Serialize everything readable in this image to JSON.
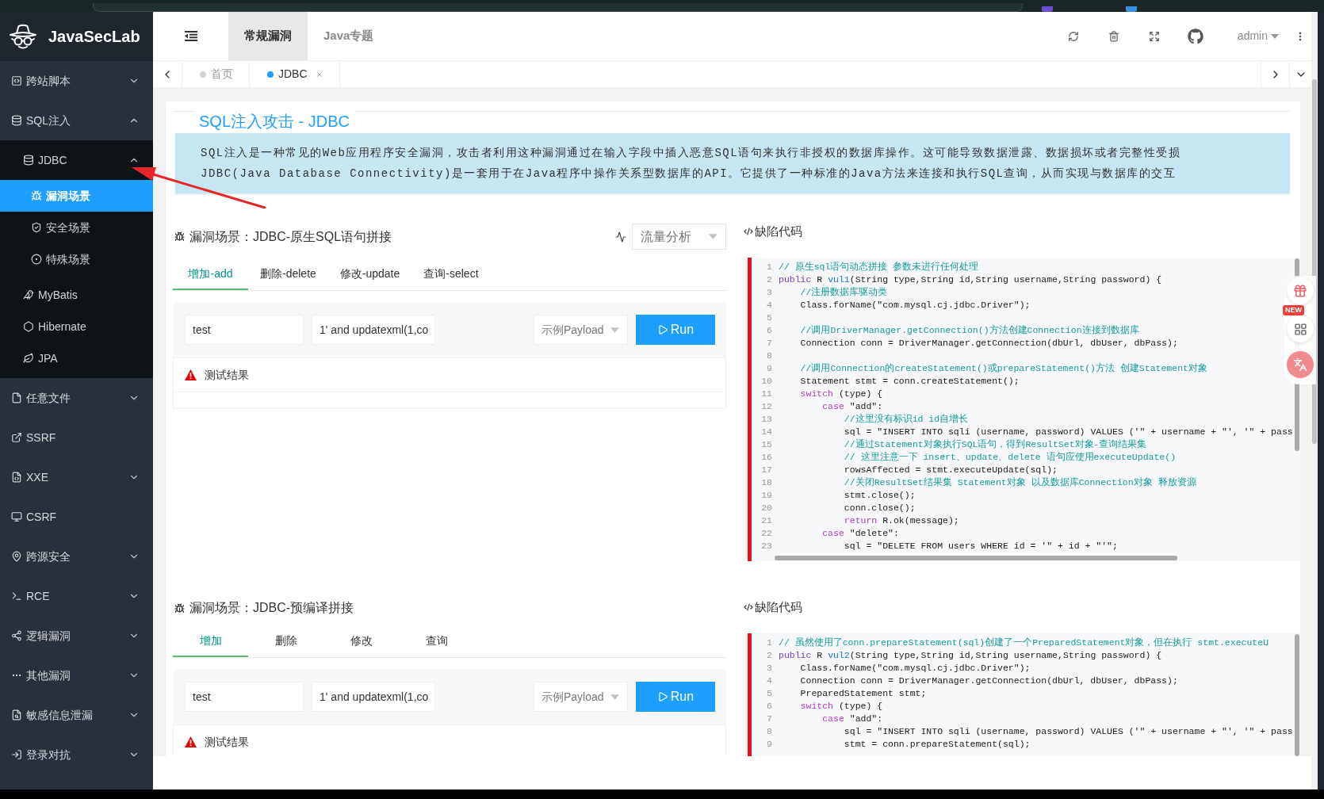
{
  "sidebar": {
    "logo": "JavaSecLab",
    "items": [
      {
        "label": "跨站脚本",
        "expanded": false,
        "selected": false
      },
      {
        "label": "SQL注入",
        "expanded": true,
        "selected": false,
        "children": [
          {
            "label": "JDBC",
            "expanded": true,
            "selected": false,
            "children": [
              {
                "label": "漏洞场景",
                "selected": true
              },
              {
                "label": "安全场景",
                "selected": false
              },
              {
                "label": "特殊场景",
                "selected": false
              }
            ]
          },
          {
            "label": "MyBatis",
            "selected": false
          },
          {
            "label": "Hibernate",
            "selected": false
          },
          {
            "label": "JPA",
            "selected": false
          }
        ]
      },
      {
        "label": "任意文件",
        "expanded": false,
        "selected": false
      },
      {
        "label": "SSRF",
        "selected": false
      },
      {
        "label": "XXE",
        "expanded": false,
        "selected": false
      },
      {
        "label": "CSRF",
        "selected": false
      },
      {
        "label": "跨源安全",
        "expanded": false,
        "selected": false
      },
      {
        "label": "RCE",
        "expanded": false,
        "selected": false
      },
      {
        "label": "逻辑漏洞",
        "expanded": false,
        "selected": false
      },
      {
        "label": "其他漏洞",
        "expanded": false,
        "selected": false
      },
      {
        "label": "敏感信息泄漏",
        "expanded": false,
        "selected": false
      },
      {
        "label": "登录对抗",
        "expanded": false,
        "selected": false
      }
    ]
  },
  "header": {
    "tabs": [
      {
        "label": "常规漏洞",
        "selected": true
      },
      {
        "label": "Java专题",
        "selected": false
      }
    ],
    "user": "admin"
  },
  "page_tabs": [
    {
      "label": "首页",
      "selected": false,
      "closable": false
    },
    {
      "label": "JDBC",
      "selected": true,
      "closable": true
    }
  ],
  "card": {
    "title": "SQL注入攻击 - JDBC",
    "intro": [
      "SQL注入是一种常见的Web应用程序安全漏洞，攻击者利用这种漏洞通过在输入字段中插入恶意SQL语句来执行非授权的数据库操作。这可能导致数据泄露、数据损坏或者完整性受损",
      "JDBC(Java Database Connectivity)是一套用于在Java程序中操作关系型数据库的API。它提供了一种标准的Java方法来连接和执行SQL查询，从而实现与数据库的交互"
    ]
  },
  "scenarios": [
    {
      "title": "漏洞场景：JDBC-原生SQL语句拼接",
      "traffic_select": {
        "placeholder": "流量分析"
      },
      "tabs": [
        {
          "label": "增加-add",
          "selected": true
        },
        {
          "label": "删除-delete",
          "selected": false
        },
        {
          "label": "修改-update",
          "selected": false
        },
        {
          "label": "查询-select",
          "selected": false
        }
      ],
      "fields": [
        {
          "value": "test"
        },
        {
          "value": "1' and updatexml(1,co"
        }
      ],
      "payload_select": {
        "placeholder": "示例Payload"
      },
      "run_label": "Run",
      "result_label": "测试结果",
      "code": {
        "title": "缺陷代码",
        "lines": [
          {
            "number": "1",
            "tokens": [
              {
                "kind": "comment",
                "text": "// 原生sql语句动态拼接 参数未进行任何处理"
              }
            ]
          },
          {
            "number": "2",
            "tokens": [
              {
                "kind": "modifier",
                "text": "public"
              },
              {
                "kind": "plain",
                "text": " R "
              },
              {
                "kind": "function",
                "text": "vul1"
              },
              {
                "kind": "plain",
                "text": "(String type,String id,String username,String password) {"
              }
            ]
          },
          {
            "number": "3",
            "tokens": [
              {
                "kind": "comment",
                "text": "    //注册数据库驱动类"
              }
            ]
          },
          {
            "number": "4",
            "tokens": [
              {
                "kind": "plain",
                "text": "    Class.forName(\"com.mysql.cj.jdbc.Driver\");"
              }
            ]
          },
          {
            "number": "5"
          },
          {
            "number": "6",
            "tokens": [
              {
                "kind": "comment",
                "text": "    //调用DriverManager.getConnection()方法创建Connection连接到数据库"
              }
            ]
          },
          {
            "number": "7",
            "tokens": [
              {
                "kind": "plain",
                "text": "    Connection conn = DriverManager.getConnection(dbUrl, dbUser, dbPass);"
              }
            ]
          },
          {
            "number": "8"
          },
          {
            "number": "9",
            "tokens": [
              {
                "kind": "comment",
                "text": "    //调用Connection的createStatement()或prepareStatement()方法 创建Statement对象"
              }
            ]
          },
          {
            "number": "10",
            "tokens": [
              {
                "kind": "plain",
                "text": "    Statement stmt = conn.createStatement();"
              }
            ]
          },
          {
            "number": "11",
            "tokens": [
              {
                "kind": "keyword",
                "text": "    switch"
              },
              {
                "kind": "plain",
                "text": " (type) {"
              }
            ]
          },
          {
            "number": "12",
            "tokens": [
              {
                "kind": "keyword",
                "text": "        case"
              },
              {
                "kind": "plain",
                "text": " \"add\":"
              }
            ]
          },
          {
            "number": "13",
            "tokens": [
              {
                "kind": "comment",
                "text": "            //这里没有标识id id自增长"
              }
            ]
          },
          {
            "number": "14",
            "tokens": [
              {
                "kind": "plain",
                "text": "            sql = \"INSERT INTO sqli (username, password) VALUES ('\" + username + \"', '\" + pass"
              }
            ]
          },
          {
            "number": "15",
            "tokens": [
              {
                "kind": "comment",
                "text": "            //通过Statement对象执行SQL语句，得到ResultSet对象-查询结果集"
              }
            ]
          },
          {
            "number": "16",
            "tokens": [
              {
                "kind": "comment",
                "text": "            // 这里注意一下 insert、update、delete 语句应使用executeUpdate()"
              }
            ]
          },
          {
            "number": "17",
            "tokens": [
              {
                "kind": "plain",
                "text": "            rowsAffected = stmt.executeUpdate(sql);"
              }
            ]
          },
          {
            "number": "18",
            "tokens": [
              {
                "kind": "comment",
                "text": "            //关闭ResultSet结果集 Statement对象 以及数据库Connection对象 释放资源"
              }
            ]
          },
          {
            "number": "19",
            "tokens": [
              {
                "kind": "plain",
                "text": "            stmt.close();"
              }
            ]
          },
          {
            "number": "20",
            "tokens": [
              {
                "kind": "plain",
                "text": "            conn.close();"
              }
            ]
          },
          {
            "number": "21",
            "tokens": [
              {
                "kind": "keyword",
                "text": "            return"
              },
              {
                "kind": "plain",
                "text": " R.ok(message);"
              }
            ]
          },
          {
            "number": "22",
            "tokens": [
              {
                "kind": "keyword",
                "text": "        case"
              },
              {
                "kind": "plain",
                "text": " \"delete\":"
              }
            ]
          },
          {
            "number": "23",
            "tokens": [
              {
                "kind": "plain",
                "text": "            sql = \"DELETE FROM users WHERE id = '\" + id + \"'\";"
              }
            ]
          }
        ]
      }
    },
    {
      "title": "漏洞场景：JDBC-预编译拼接",
      "tabs": [
        {
          "label": "增加",
          "selected": true
        },
        {
          "label": "删除",
          "selected": false
        },
        {
          "label": "修改",
          "selected": false
        },
        {
          "label": "查询",
          "selected": false
        }
      ],
      "fields": [
        {
          "value": "test"
        },
        {
          "value": "1' and updatexml(1,co"
        }
      ],
      "payload_select": {
        "placeholder": "示例Payload"
      },
      "run_label": "Run",
      "result_label": "测试结果",
      "code": {
        "title": "缺陷代码",
        "lines": [
          {
            "number": "1",
            "tokens": [
              {
                "kind": "comment",
                "text": "// 虽然使用了conn.prepareStatement(sql)创建了一个PreparedStatement对象，但在执行 stmt.executeU"
              }
            ]
          },
          {
            "number": "2",
            "tokens": [
              {
                "kind": "modifier",
                "text": "public"
              },
              {
                "kind": "plain",
                "text": " R "
              },
              {
                "kind": "function",
                "text": "vul2"
              },
              {
                "kind": "plain",
                "text": "(String type,String id,String username,String password) {"
              }
            ]
          },
          {
            "number": "3",
            "tokens": [
              {
                "kind": "plain",
                "text": "    Class.forName(\"com.mysql.cj.jdbc.Driver\");"
              }
            ]
          },
          {
            "number": "4",
            "tokens": [
              {
                "kind": "plain",
                "text": "    Connection conn = DriverManager.getConnection(dbUrl, dbUser, dbPass);"
              }
            ]
          },
          {
            "number": "5",
            "tokens": [
              {
                "kind": "plain",
                "text": "    PreparedStatement stmt;"
              }
            ]
          },
          {
            "number": "6",
            "tokens": [
              {
                "kind": "keyword",
                "text": "    switch"
              },
              {
                "kind": "plain",
                "text": " (type) {"
              }
            ]
          },
          {
            "number": "7",
            "tokens": [
              {
                "kind": "keyword",
                "text": "        case"
              },
              {
                "kind": "plain",
                "text": " \"add\":"
              }
            ]
          },
          {
            "number": "8",
            "tokens": [
              {
                "kind": "plain",
                "text": "            sql = \"INSERT INTO sqli (username, password) VALUES ('\" + username + \"', '\" + pass"
              }
            ]
          },
          {
            "number": "9",
            "tokens": [
              {
                "kind": "plain",
                "text": "            stmt = conn.prepareStatement(sql);"
              }
            ]
          }
        ]
      }
    }
  ],
  "floating_toolbar": {
    "badge": "NEW"
  }
}
